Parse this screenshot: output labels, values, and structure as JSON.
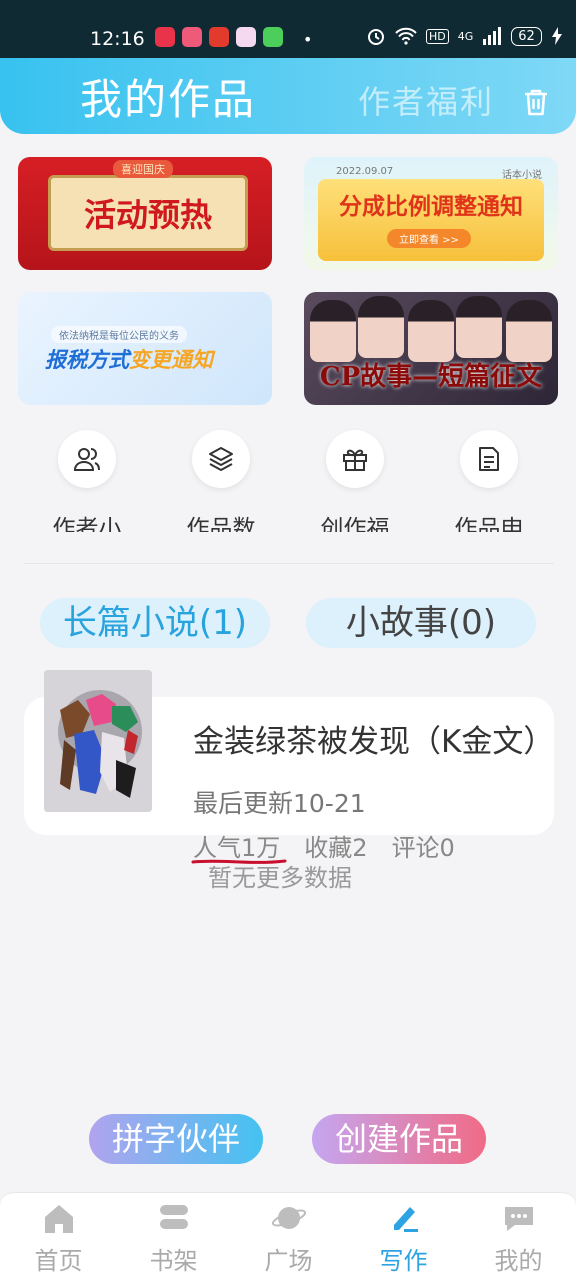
{
  "status_bar": {
    "time": "12:16",
    "battery": "62",
    "network": "4G",
    "hd": "HD",
    "dot": "•"
  },
  "header": {
    "title": "我的作品",
    "tab_benefits": "作者福利"
  },
  "banners": [
    {
      "label": "活动预热",
      "tag": "喜迎国庆"
    },
    {
      "label": "分成比例调整通知",
      "date": "2022.09.07",
      "sub": "话本小说",
      "button": "立即查看 >>"
    },
    {
      "small": "依法纳税是每位公民的义务",
      "label_a": "报税方式",
      "label_b": "变更通知"
    },
    {
      "label": "CP故事—短篇征文"
    }
  ],
  "shortcuts": [
    {
      "label": "作者小",
      "icon": "author-icon"
    },
    {
      "label": "作品数",
      "icon": "layers-icon"
    },
    {
      "label": "创作福",
      "icon": "gift-icon"
    },
    {
      "label": "作品申",
      "icon": "document-icon"
    }
  ],
  "tabs": {
    "long_novel": "长篇小说(1)",
    "short_story": "小故事(0)"
  },
  "work": {
    "title": "金装绿茶被发现（K金文）",
    "update": "最后更新10-21",
    "popularity": "人气1万",
    "favorites": "收藏2",
    "comments": "评论0"
  },
  "no_more": "暂无更多数据",
  "buttons": {
    "partner": "拼字伙伴",
    "create": "创建作品"
  },
  "bottom_nav": [
    {
      "label": "首页",
      "icon": "home-icon"
    },
    {
      "label": "书架",
      "icon": "bookshelf-icon"
    },
    {
      "label": "广场",
      "icon": "planet-icon"
    },
    {
      "label": "写作",
      "icon": "pen-icon",
      "active": true
    },
    {
      "label": "我的",
      "icon": "chat-icon"
    }
  ],
  "colors": {
    "accent": "#2ea3e3",
    "header_start": "#38c2ef",
    "status_bar": "#0f2a33"
  }
}
